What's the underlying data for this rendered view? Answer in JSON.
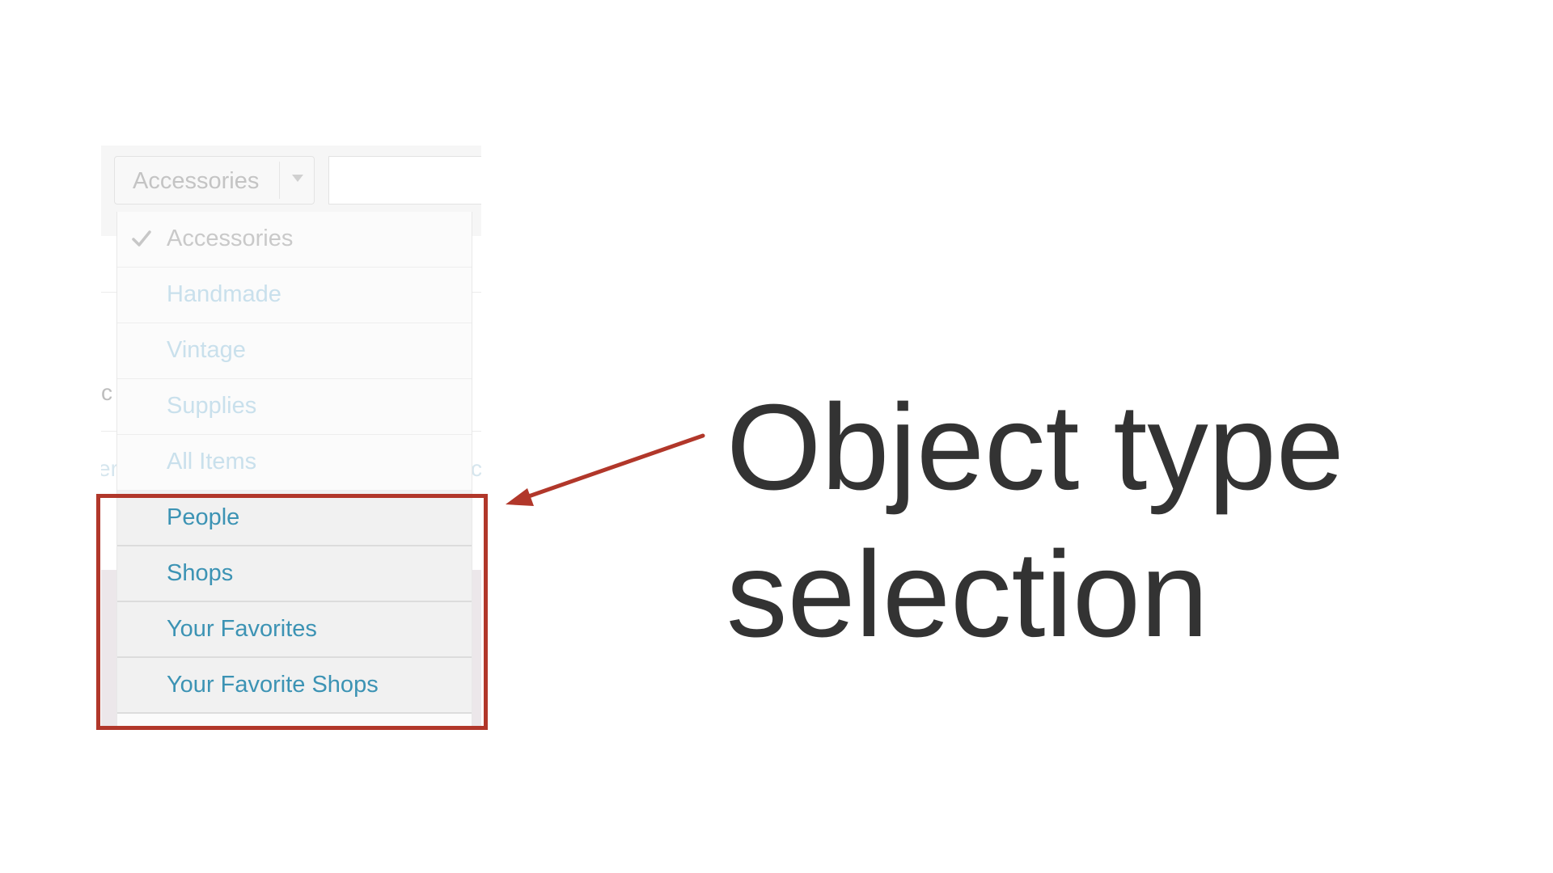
{
  "category_select": {
    "selected_value": "Accessories"
  },
  "dropdown": {
    "items": [
      {
        "label": "Accessories",
        "state": "checked"
      },
      {
        "label": "Handmade",
        "state": "faded"
      },
      {
        "label": "Vintage",
        "state": "faded"
      },
      {
        "label": "Supplies",
        "state": "faded"
      },
      {
        "label": "All Items",
        "state": "faded"
      },
      {
        "label": "People",
        "state": "highlighted"
      },
      {
        "label": "Shops",
        "state": "highlighted"
      },
      {
        "label": "Your Favorites",
        "state": "highlighted"
      },
      {
        "label": "Your Favorite Shops",
        "state": "highlighted"
      }
    ]
  },
  "background_fragments": {
    "letter_1": "c",
    "letter_2": "er",
    "letter_3": "c"
  },
  "annotation": {
    "caption_line_1": "Object type",
    "caption_line_2": "selection",
    "highlight_color": "#b1372a"
  },
  "icons": {
    "check": "check-icon",
    "caret": "chevron-down-icon"
  }
}
